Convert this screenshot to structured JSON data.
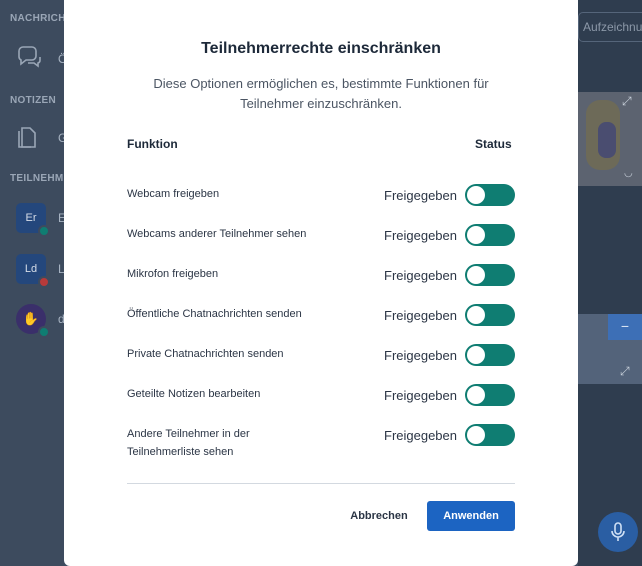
{
  "background": {
    "sections": [
      {
        "label": "NACHRICHTEN"
      },
      {
        "label": "NOTIZEN"
      },
      {
        "label": "TEILNEHMER"
      }
    ],
    "chat_item_char": "Ö",
    "notes_item_char": "G",
    "participants": [
      {
        "initials": "Er",
        "char": "E",
        "bg": "#24477c",
        "dot": "#0f7d72"
      },
      {
        "initials": "Ld",
        "char": "L",
        "bg": "#24477c",
        "dot": "#b73a3a"
      },
      {
        "initials": "",
        "char": "d",
        "bg": "#3a2f6a",
        "dot": "#0f7d72"
      }
    ],
    "recording_label": "Aufzeichnung"
  },
  "modal": {
    "title": "Teilnehmerrechte einschränken",
    "description": "Diese Optionen ermöglichen es, bestimmte Funktionen für Teilnehmer einzuschränken.",
    "column_function": "Funktion",
    "column_status": "Status",
    "rows": [
      {
        "label": "Webcam freigeben",
        "status": "Freigegeben",
        "enabled": true
      },
      {
        "label": "Webcams anderer Teilnehmer sehen",
        "status": "Freigegeben",
        "enabled": true
      },
      {
        "label": "Mikrofon freigeben",
        "status": "Freigegeben",
        "enabled": true
      },
      {
        "label": "Öffentliche Chatnachrichten senden",
        "status": "Freigegeben",
        "enabled": true
      },
      {
        "label": "Private Chatnachrichten senden",
        "status": "Freigegeben",
        "enabled": true
      },
      {
        "label": "Geteilte Notizen bearbeiten",
        "status": "Freigegeben",
        "enabled": true
      },
      {
        "label": "Andere Teilnehmer in der Teilnehmerliste sehen",
        "status": "Freigegeben",
        "enabled": true
      }
    ],
    "cancel_label": "Abbrechen",
    "apply_label": "Anwenden"
  },
  "colors": {
    "toggle_on": "#0f7d72",
    "primary_button": "#1c64c2",
    "backdrop": "#3d4b5e"
  }
}
